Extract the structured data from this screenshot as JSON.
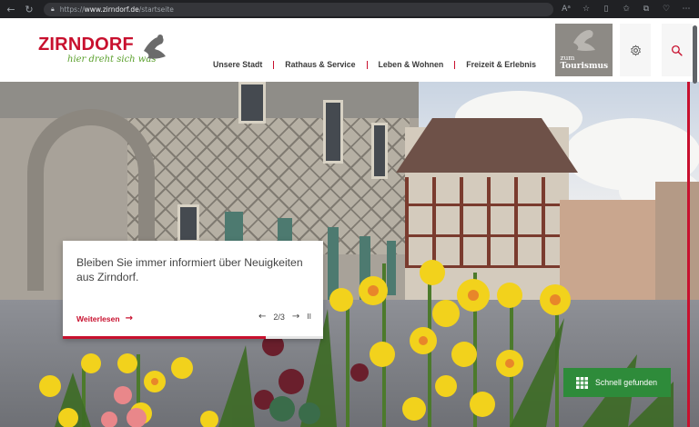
{
  "browser": {
    "url_protocol": "https://",
    "url_host": "www.zirndorf.de",
    "url_path": "/startseite",
    "back_icon": "arrow-left-icon",
    "reload_icon": "reload-icon"
  },
  "logo": {
    "wordmark": "ZIRNDORF",
    "tagline": "hier dreht sich was"
  },
  "nav": {
    "items": [
      {
        "label": "Unsere Stadt"
      },
      {
        "label": "Rathaus & Service"
      },
      {
        "label": "Leben & Wohnen"
      },
      {
        "label": "Freizeit & Erlebnis"
      }
    ]
  },
  "tourism": {
    "line1": "zum",
    "line2": "Tourismus"
  },
  "header_icons": {
    "settings": "gear-icon",
    "search": "search-icon"
  },
  "news_card": {
    "text": "Bleiben Sie immer informiert über Neuigkeiten aus Zirndorf.",
    "more_label": "Weiterlesen",
    "arrow": "→",
    "pager": "2/3",
    "prev_symbol": "←",
    "next_symbol": "→",
    "pause_symbol": "II",
    "progress": 0.78
  },
  "quick_button": {
    "label": "Schnell gefunden"
  },
  "colors": {
    "brand_red": "#c8102e",
    "brand_green": "#5aa02c",
    "quick_green": "#2e8b3a"
  }
}
